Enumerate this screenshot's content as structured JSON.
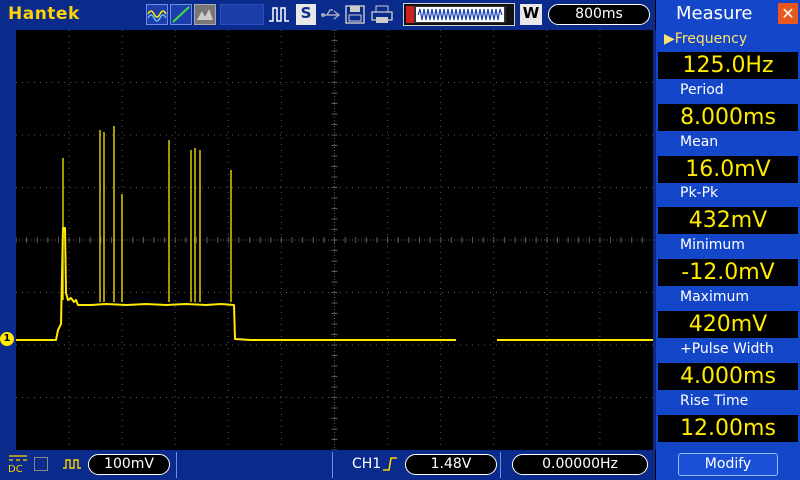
{
  "topbar": {
    "brand": "Hantek",
    "save_mode_label": "S",
    "waveform_label": "W",
    "timebase": "800ms"
  },
  "left": {
    "channel_marker": "1"
  },
  "bottombar": {
    "coupling_label": "DC",
    "volts_per_div": "100mV",
    "trigger_source": "CH1",
    "trigger_edge_icon": "rising-edge-icon",
    "trigger_level": "1.48V",
    "trigger_frequency": "0.00000Hz"
  },
  "measure": {
    "title": "Measure",
    "items": [
      {
        "label": "Frequency",
        "value": "125.0Hz",
        "selected": true
      },
      {
        "label": "Period",
        "value": "8.000ms"
      },
      {
        "label": "Mean",
        "value": "16.0mV"
      },
      {
        "label": "Pk-Pk",
        "value": "432mV"
      },
      {
        "label": "Minimum",
        "value": "-12.0mV"
      },
      {
        "label": "Maximum",
        "value": "420mV"
      },
      {
        "label": "+Pulse Width",
        "value": "4.000ms"
      },
      {
        "label": "Rise Time",
        "value": "12.00ms"
      }
    ],
    "modify_label": "Modify"
  },
  "colors": {
    "bar_blue": "#0b2b8c",
    "panel_blue": "#1346c8",
    "trace_yellow": "#ffea00",
    "grid_gray": "#5a5a5a",
    "close_orange": "#e8581e"
  }
}
